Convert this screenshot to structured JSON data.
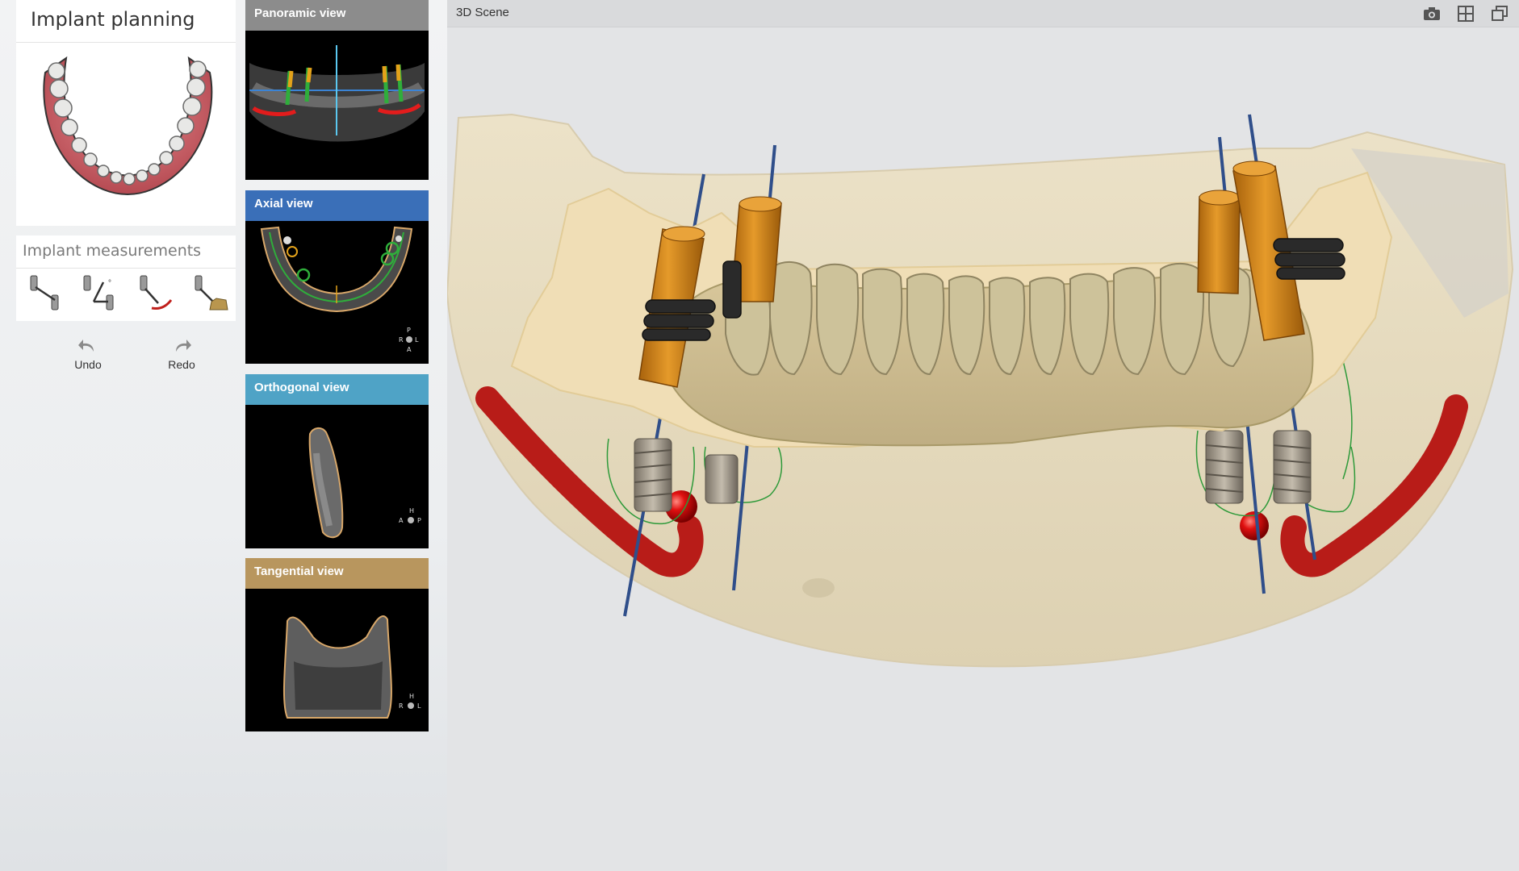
{
  "planning": {
    "title": "Implant planning"
  },
  "measurements": {
    "title": "Implant measurements",
    "tools": [
      {
        "icon": "implant-distance-icon"
      },
      {
        "icon": "implant-angle-icon"
      },
      {
        "icon": "implant-nerve-distance-icon"
      },
      {
        "icon": "implant-bone-distance-icon"
      }
    ],
    "undo_label": "Undo",
    "redo_label": "Redo"
  },
  "views": {
    "panoramic": {
      "label": "Panoramic view",
      "color": "#8c8c8c"
    },
    "axial": {
      "label": "Axial view",
      "color": "#3a6fb8",
      "orientation": [
        "P",
        "R",
        "L",
        "A"
      ]
    },
    "orthogonal": {
      "label": "Orthogonal view",
      "color": "#4fa3c6",
      "orientation": [
        "H",
        "A",
        "P"
      ]
    },
    "tangential": {
      "label": "Tangential view",
      "color": "#b8965e",
      "orientation": [
        "H",
        "R",
        "L"
      ]
    }
  },
  "scene": {
    "title": "3D Scene",
    "icons": [
      "camera-icon",
      "layout-grid-icon",
      "restore-window-icon"
    ]
  },
  "colors": {
    "implant_orange": "#d98a1a",
    "nerve_red": "#c0201c",
    "bone": "#e8dcc0",
    "teeth": "#cfc59f"
  }
}
